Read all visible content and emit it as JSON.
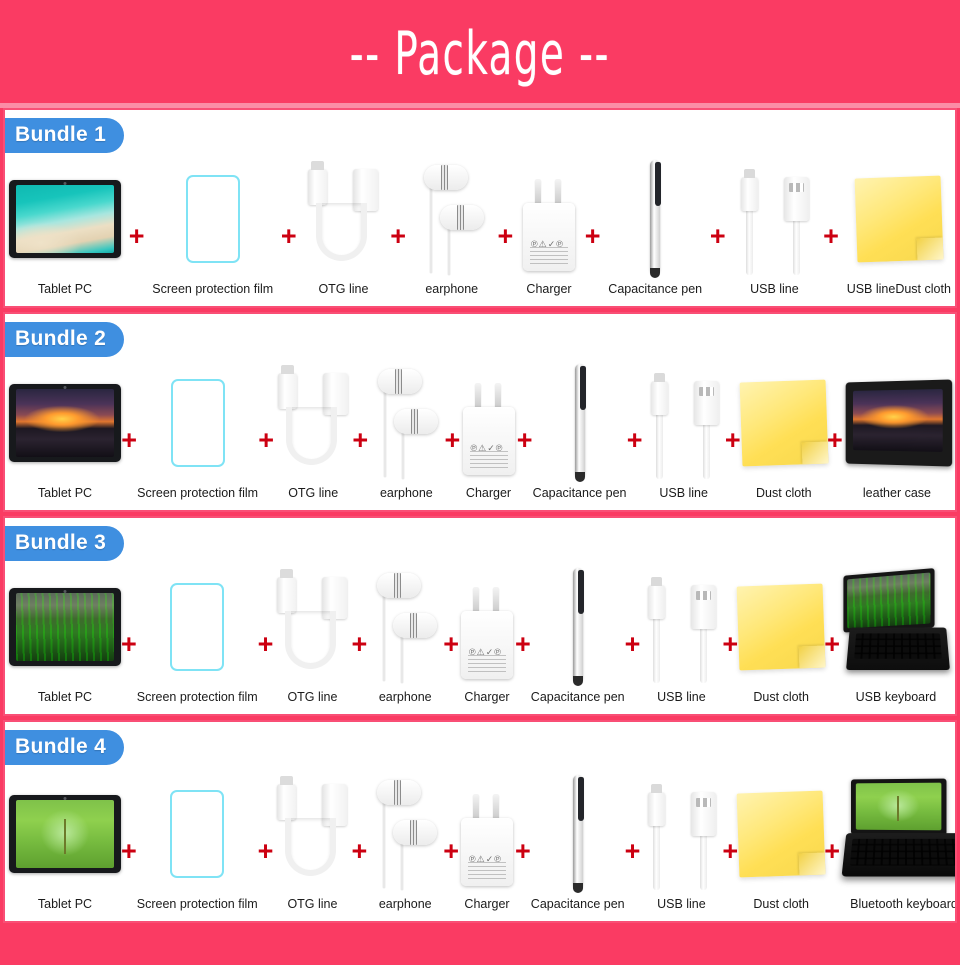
{
  "header": {
    "title": "-- Package --"
  },
  "colors": {
    "background_pink": "#fa3b63",
    "header_rule": "#fb8da6",
    "badge_blue": "#3f8fe0",
    "plus_red": "#cc0011",
    "film_outline": "#7fe3f5",
    "cloth_yellow": "#ffdf55",
    "card_border": "#f94f76"
  },
  "plus_symbol": "+",
  "bundles": [
    {
      "badge": "Bundle 1",
      "items": [
        {
          "label": "Tablet PC",
          "icon": "tablet-beach-icon"
        },
        {
          "label": "Screen protection film",
          "icon": "screen-film-icon"
        },
        {
          "label": "OTG line",
          "icon": "otg-cable-icon"
        },
        {
          "label": "earphone",
          "icon": "earphone-icon"
        },
        {
          "label": "Charger",
          "icon": "charger-icon"
        },
        {
          "label": "Capacitance pen",
          "icon": "stylus-pen-icon"
        },
        {
          "label": "USB line",
          "icon": "usb-cable-icon"
        },
        {
          "label": "USB lineDust cloth",
          "icon": "dust-cloth-icon"
        }
      ]
    },
    {
      "badge": "Bundle 2",
      "items": [
        {
          "label": "Tablet PC",
          "icon": "tablet-sunset-icon"
        },
        {
          "label": "Screen protection film",
          "icon": "screen-film-icon"
        },
        {
          "label": "OTG line",
          "icon": "otg-cable-icon"
        },
        {
          "label": "earphone",
          "icon": "earphone-icon"
        },
        {
          "label": "Charger",
          "icon": "charger-icon"
        },
        {
          "label": "Capacitance pen",
          "icon": "stylus-pen-icon"
        },
        {
          "label": "USB line",
          "icon": "usb-cable-icon"
        },
        {
          "label": "Dust cloth",
          "icon": "dust-cloth-icon"
        },
        {
          "label": "leather case",
          "icon": "leather-case-icon"
        }
      ]
    },
    {
      "badge": "Bundle 3",
      "items": [
        {
          "label": "Tablet PC",
          "icon": "tablet-grass-icon"
        },
        {
          "label": "Screen protection film",
          "icon": "screen-film-icon"
        },
        {
          "label": "OTG line",
          "icon": "otg-cable-icon"
        },
        {
          "label": "earphone",
          "icon": "earphone-icon"
        },
        {
          "label": "Charger",
          "icon": "charger-icon"
        },
        {
          "label": "Capacitance pen",
          "icon": "stylus-pen-icon"
        },
        {
          "label": "USB line",
          "icon": "usb-cable-icon"
        },
        {
          "label": "Dust cloth",
          "icon": "dust-cloth-icon"
        },
        {
          "label": "USB keyboard",
          "icon": "usb-keyboard-icon"
        }
      ]
    },
    {
      "badge": "Bundle 4",
      "items": [
        {
          "label": "Tablet PC",
          "icon": "tablet-plant-icon"
        },
        {
          "label": "Screen protection film",
          "icon": "screen-film-icon"
        },
        {
          "label": "OTG line",
          "icon": "otg-cable-icon"
        },
        {
          "label": "earphone",
          "icon": "earphone-icon"
        },
        {
          "label": "Charger",
          "icon": "charger-icon"
        },
        {
          "label": "Capacitance pen",
          "icon": "stylus-pen-icon"
        },
        {
          "label": "USB line",
          "icon": "usb-cable-icon"
        },
        {
          "label": "Dust cloth",
          "icon": "dust-cloth-icon"
        },
        {
          "label": "Bluetooth keyboard",
          "icon": "bluetooth-keyboard-icon"
        }
      ]
    }
  ]
}
